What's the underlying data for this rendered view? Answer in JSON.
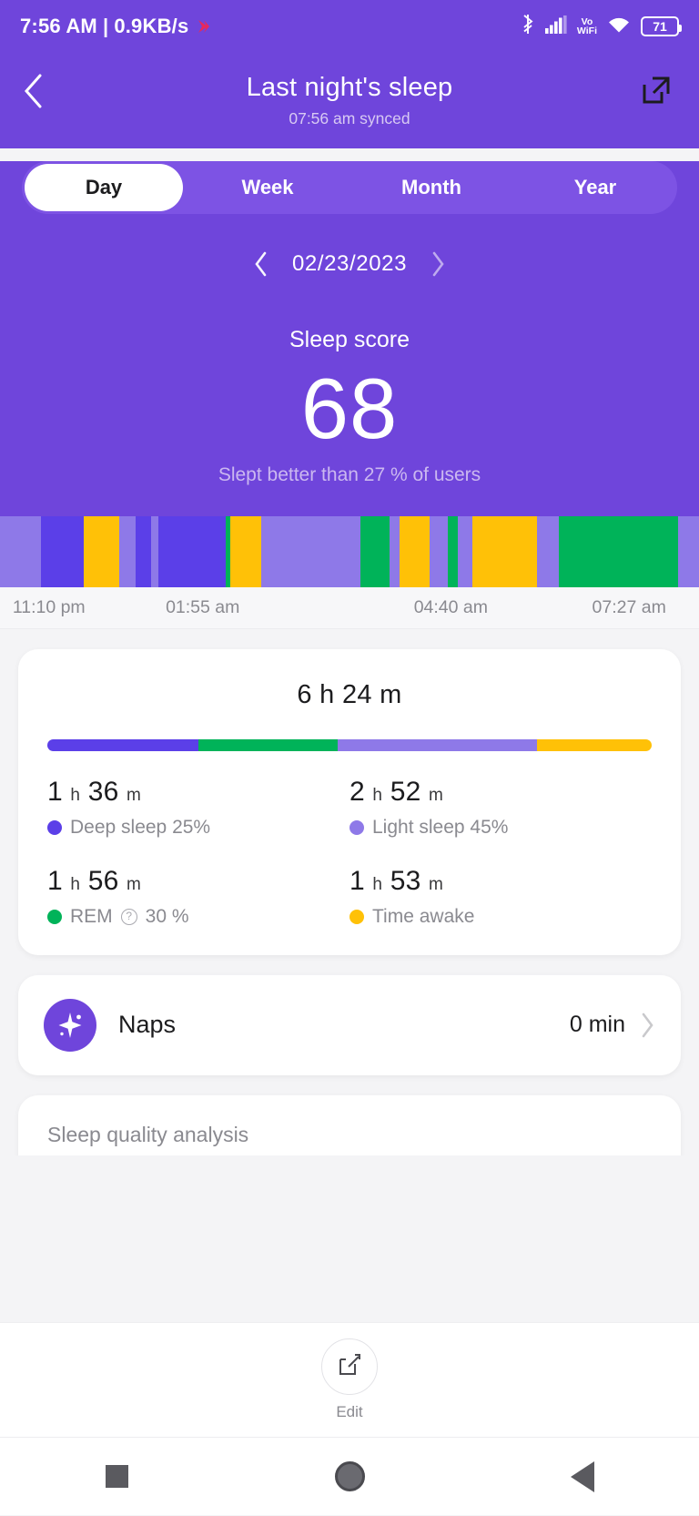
{
  "status_bar": {
    "time": "7:56 AM",
    "separator": "|",
    "network_speed": "0.9KB/s",
    "net_arrow_icon": "data-arrow-icon",
    "bluetooth_icon": "bluetooth-icon",
    "signal_icon": "cellular-signal-icon",
    "vowifi_line1": "Vo",
    "vowifi_line2": "WiFi",
    "wifi_icon": "wifi-icon",
    "battery_level": "71",
    "battery_icon": "battery-icon"
  },
  "header": {
    "back_icon": "chevron-left-icon",
    "title": "Last night's sleep",
    "subtitle": "07:56 am synced",
    "share_icon": "share-external-icon"
  },
  "tabs": {
    "items": [
      {
        "label": "Day",
        "active": true
      },
      {
        "label": "Week",
        "active": false
      },
      {
        "label": "Month",
        "active": false
      },
      {
        "label": "Year",
        "active": false
      }
    ]
  },
  "date_nav": {
    "prev_icon": "chevron-left-icon",
    "next_icon": "chevron-right-icon",
    "date": "02/23/2023"
  },
  "sleep_score": {
    "title": "Sleep score",
    "value": "68",
    "comparison": "Slept better than 27 % of users"
  },
  "colors": {
    "brand_purple": "#6f45db",
    "deep_sleep": "#5b3fe8",
    "light_sleep": "#8e79e8",
    "rem": "#00b359",
    "awake": "#ffc107",
    "tab_track": "#7d53e4"
  },
  "chart_data": {
    "type": "bar",
    "title": "Sleep stages hypnogram",
    "xlabel": "",
    "ylabel": "",
    "grid": false,
    "legend_position": "below-in-card",
    "x_tick_labels": [
      "11:10 pm",
      "01:55 am",
      "04:40 am",
      "07:27 am"
    ],
    "x_tick_positions_pct": [
      7,
      29,
      64.5,
      90
    ],
    "start_time": "11:10 pm",
    "end_time": "07:27 am",
    "categories": [
      "Deep sleep",
      "Light sleep",
      "REM",
      "Time awake"
    ],
    "category_colors": [
      "#5b3fe8",
      "#8e79e8",
      "#00b359",
      "#ffc107"
    ],
    "values_minutes": [
      96,
      172,
      116,
      113
    ],
    "values_percent": [
      25,
      45,
      30,
      22
    ],
    "segments": [
      {
        "stage": "Light sleep",
        "color": "#8e79e8",
        "width_pct": 5.8
      },
      {
        "stage": "Deep sleep",
        "color": "#5b3fe8",
        "width_pct": 6.2
      },
      {
        "stage": "Time awake",
        "color": "#ffc107",
        "width_pct": 5.0
      },
      {
        "stage": "Light sleep",
        "color": "#8e79e8",
        "width_pct": 2.4
      },
      {
        "stage": "Deep sleep",
        "color": "#5b3fe8",
        "width_pct": 2.2
      },
      {
        "stage": "Light sleep",
        "color": "#8e79e8",
        "width_pct": 1.1
      },
      {
        "stage": "Deep sleep",
        "color": "#5b3fe8",
        "width_pct": 9.6
      },
      {
        "stage": "REM",
        "color": "#00b359",
        "width_pct": 0.7
      },
      {
        "stage": "Time awake",
        "color": "#ffc107",
        "width_pct": 4.4
      },
      {
        "stage": "Light sleep",
        "color": "#8e79e8",
        "width_pct": 14.2
      },
      {
        "stage": "REM",
        "color": "#00b359",
        "width_pct": 4.1
      },
      {
        "stage": "Light sleep",
        "color": "#8e79e8",
        "width_pct": 1.5
      },
      {
        "stage": "Time awake",
        "color": "#ffc107",
        "width_pct": 4.3
      },
      {
        "stage": "Light sleep",
        "color": "#8e79e8",
        "width_pct": 2.6
      },
      {
        "stage": "REM",
        "color": "#00b359",
        "width_pct": 1.4
      },
      {
        "stage": "Light sleep",
        "color": "#8e79e8",
        "width_pct": 2.1
      },
      {
        "stage": "Time awake",
        "color": "#ffc107",
        "width_pct": 9.3
      },
      {
        "stage": "Light sleep",
        "color": "#8e79e8",
        "width_pct": 3.1
      },
      {
        "stage": "REM",
        "color": "#00b359",
        "width_pct": 17.0
      }
    ]
  },
  "stages_card": {
    "total_duration": "6 h 24 m",
    "bar_segments": [
      {
        "color": "#5b3fe8",
        "width_pct": 25
      },
      {
        "color": "#00b359",
        "width_pct": 23
      },
      {
        "color": "#8e79e8",
        "width_pct": 33
      },
      {
        "color": "#ffc107",
        "width_pct": 19
      }
    ],
    "stats": [
      {
        "hours": "1",
        "h_unit": "h",
        "minutes": "36",
        "m_unit": "m",
        "label": "Deep sleep 25%",
        "dot_color": "#5b3fe8",
        "has_info": false
      },
      {
        "hours": "2",
        "h_unit": "h",
        "minutes": "52",
        "m_unit": "m",
        "label": "Light sleep 45%",
        "dot_color": "#8e79e8",
        "has_info": false
      },
      {
        "hours": "1",
        "h_unit": "h",
        "minutes": "56",
        "m_unit": "m",
        "label": "REM",
        "label_suffix": "30 %",
        "dot_color": "#00b359",
        "has_info": true
      },
      {
        "hours": "1",
        "h_unit": "h",
        "minutes": "53",
        "m_unit": "m",
        "label": "Time awake",
        "dot_color": "#ffc107",
        "has_info": false
      }
    ]
  },
  "naps_card": {
    "icon": "nap-sparkle-icon",
    "label": "Naps",
    "value": "0 min",
    "chevron_icon": "chevron-right-icon"
  },
  "analysis_card": {
    "title": "Sleep quality analysis"
  },
  "bottom_action": {
    "edit_icon": "edit-pencil-icon",
    "edit_label": "Edit"
  },
  "nav_bar": {
    "recents_icon": "square-recents-icon",
    "home_icon": "circle-home-icon",
    "back_icon": "triangle-back-icon"
  }
}
